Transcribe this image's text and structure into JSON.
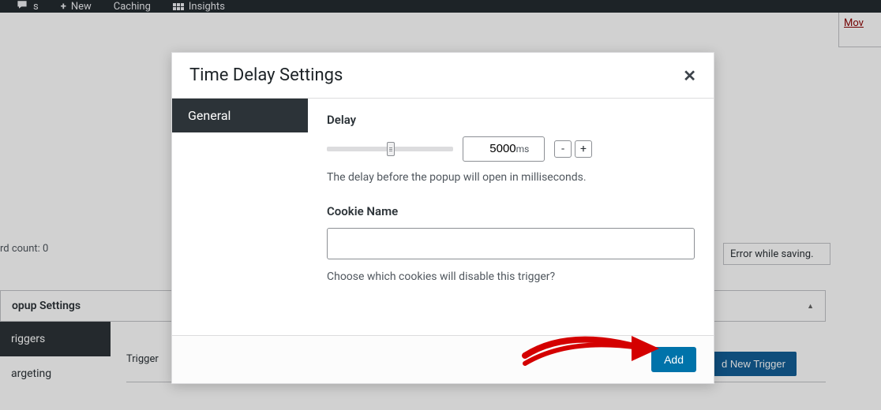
{
  "adminbar": {
    "items": [
      "s",
      "New",
      "Caching",
      "Insights"
    ]
  },
  "topRight": {
    "link": "Mov"
  },
  "wordCount": "rd count: 0",
  "errorBox": "Error while saving.",
  "panel": {
    "title": "opup Settings"
  },
  "sideTabs": [
    "riggers",
    "argeting"
  ],
  "triggerLabel": "Trigger",
  "newTriggerBtn": "d New Trigger",
  "modal": {
    "title": "Time Delay Settings",
    "tab": "General",
    "delay": {
      "label": "Delay",
      "value": "5000",
      "unit": "ms",
      "minus": "-",
      "plus": "+",
      "help": "The delay before the popup will open in milliseconds."
    },
    "cookie": {
      "label": "Cookie Name",
      "value": "",
      "help": "Choose which cookies will disable this trigger?"
    },
    "addBtn": "Add"
  }
}
